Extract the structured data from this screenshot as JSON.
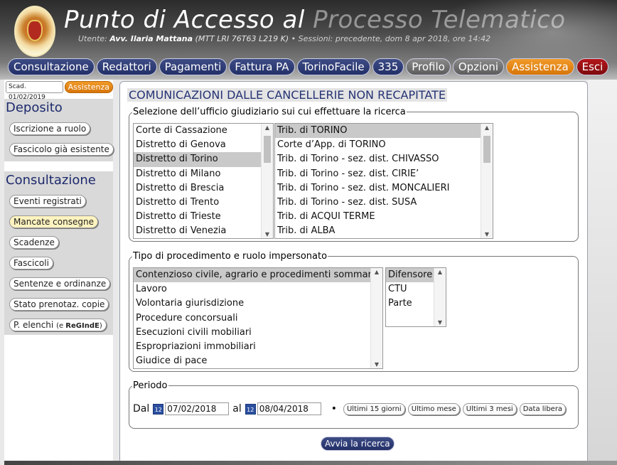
{
  "header": {
    "title_main": "Punto di Accesso al",
    "title_faded": " Processo Telematico",
    "user_prefix": "Utente: ",
    "user_name": "Avv. Ilaria Mattana",
    "user_code": " (MTT LRI 76T63 L219 K)",
    "sessions": "  •  Sessioni:  precedente, dom 8 apr 2018, ore 14:42"
  },
  "nav": [
    {
      "label": "Consultazione",
      "style": "blue"
    },
    {
      "label": "Redattori",
      "style": "blue"
    },
    {
      "label": "Pagamenti",
      "style": "blue"
    },
    {
      "label": "Fattura PA",
      "style": "blue"
    },
    {
      "label": "TorinoFacile",
      "style": "blue"
    },
    {
      "label": "335",
      "style": "blue"
    },
    {
      "label": "Profilo",
      "style": "gray"
    },
    {
      "label": "Opzioni",
      "style": "gray"
    },
    {
      "label": "Assistenza",
      "style": "orange"
    },
    {
      "label": "Esci",
      "style": "red"
    }
  ],
  "sidebar": {
    "scad_label": "Scad. 01/02/2019",
    "assist_label": "Assistenza",
    "deposito_title": "Deposito",
    "deposito_items": [
      "Iscrizione a ruolo",
      "Fascicolo già esistente"
    ],
    "consultazione_title": "Consultazione",
    "consultazione_items": [
      "Eventi registrati",
      "Mancate consegne",
      "Scadenze",
      "Fascicoli",
      "Sentenze e ordinanze",
      "Stato prenotaz. copie"
    ],
    "elenchi_prefix": "P. elenchi ",
    "elenchi_small": "(e ",
    "elenchi_bold": "ReGIndE",
    "elenchi_suffix": ")"
  },
  "main": {
    "title": "COMUNICAZIONI DALLE CANCELLERIE NON RECAPITATE",
    "office_legend": "Selezione dell’ufficio giudiziario sui cui effettuare la ricerca",
    "districts": [
      "Corte di Cassazione",
      "Distretto di Genova",
      "Distretto di Torino",
      "Distretto di Milano",
      "Distretto di Brescia",
      "Distretto di Trento",
      "Distretto di Trieste",
      "Distretto di Venezia"
    ],
    "districts_selected": "Distretto di Torino",
    "offices": [
      "Trib. di TORINO",
      "Corte d’App. di TORINO",
      "Trib. di Torino - sez. dist. CHIVASSO",
      "Trib. di Torino - sez. dist. CIRIE’",
      "Trib. di Torino - sez. dist. MONCALIERI",
      "Trib. di Torino - sez. dist. SUSA",
      "Trib. di ACQUI TERME",
      "Trib. di ALBA"
    ],
    "offices_selected": "Trib. di TORINO",
    "proc_legend": "Tipo di procedimento e ruolo impersonato",
    "procedures": [
      "Contenzioso civile, agrario e procedimenti sommari",
      "Lavoro",
      "Volontaria giurisdizione",
      "Procedure concorsuali",
      "Esecuzioni civili mobiliari",
      "Espropriazioni immobiliari",
      "Giudice di pace"
    ],
    "procedures_selected": "Contenzioso civile, agrario e procedimenti sommari",
    "roles": [
      "Difensore",
      "CTU",
      "Parte"
    ],
    "roles_selected": "Difensore",
    "period_legend": "Periodo",
    "from_label": "Dal",
    "to_label": "al",
    "from_value": "07/02/2018",
    "to_value": "08/04/2018",
    "cal_icon_text": "12",
    "bullet": "•",
    "quick_buttons": [
      "Ultimi 15 giorni",
      "Ultimo mese",
      "Ultimi 3 mesi",
      "Data libera"
    ],
    "search_label": "Avvia la ricerca"
  }
}
